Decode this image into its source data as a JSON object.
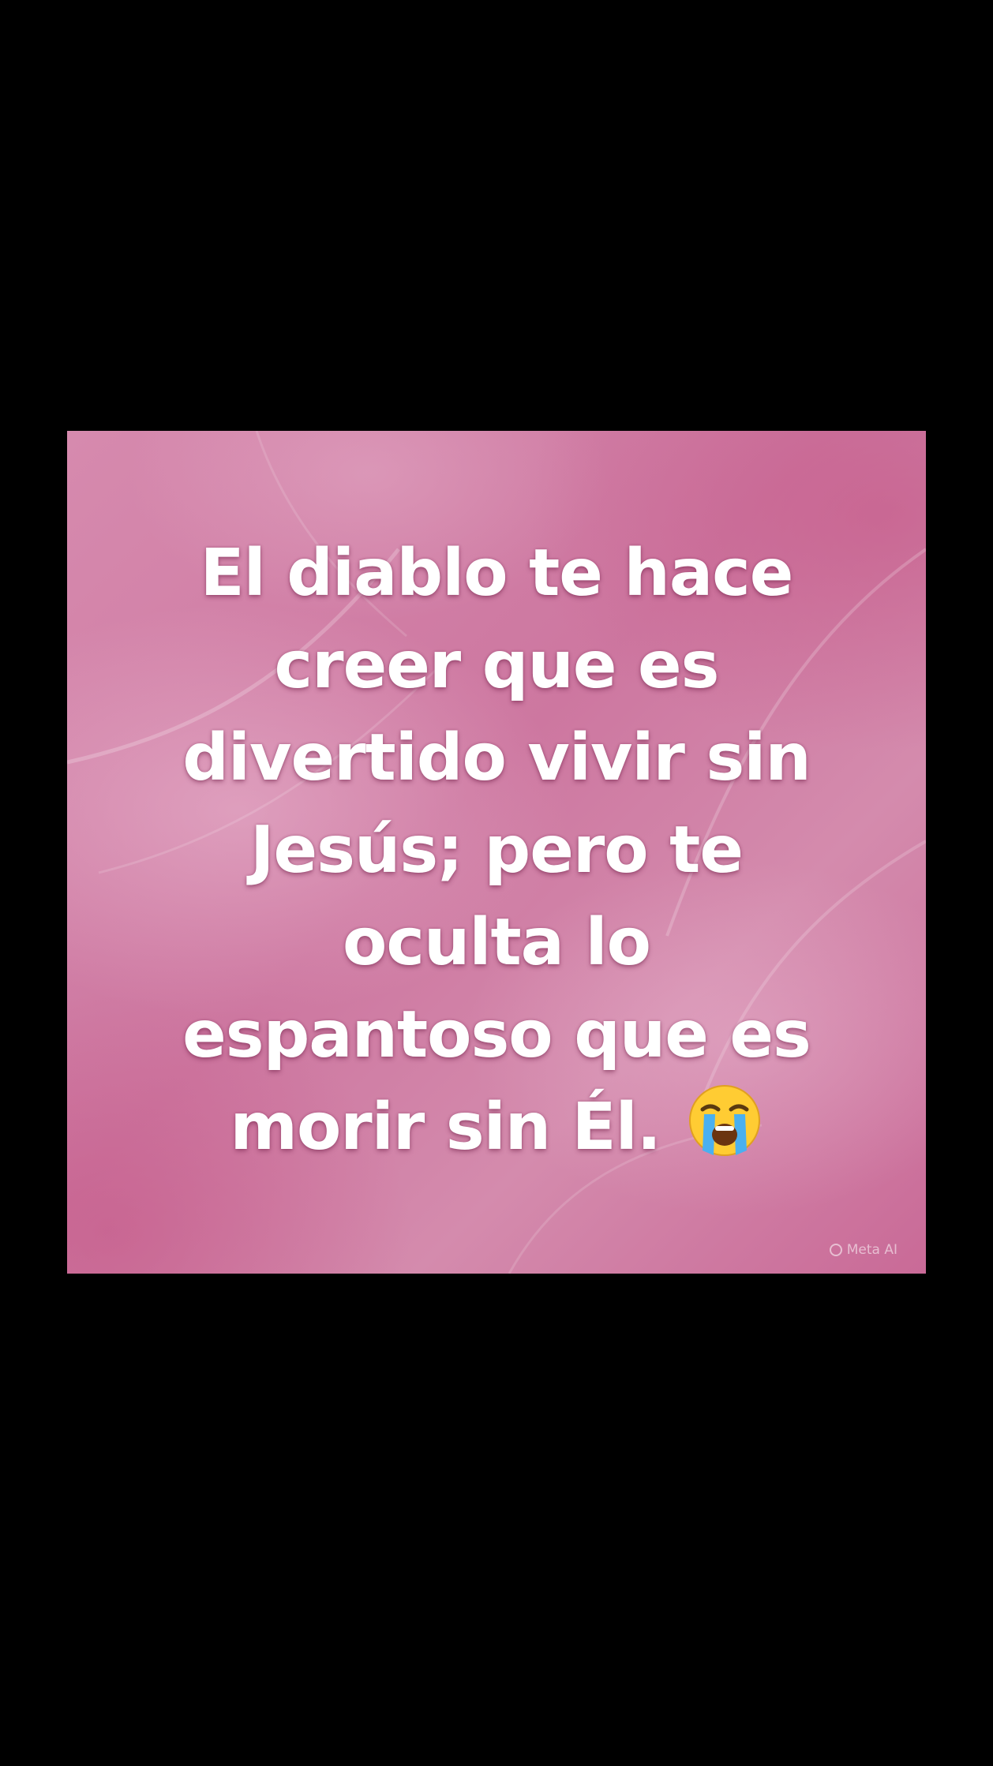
{
  "image": {
    "quote_lines": [
      "El diablo te hace",
      "creer que es",
      "divertido vivir sin",
      "Jesús; pero te",
      "oculta lo",
      "espantoso que es",
      "morir sin Él."
    ],
    "emoji": "loudly-crying-face",
    "watermark": "Meta AI"
  },
  "colors": {
    "page_background": "#000000",
    "card_pink": "#cd77a0",
    "text": "#ffffff"
  }
}
